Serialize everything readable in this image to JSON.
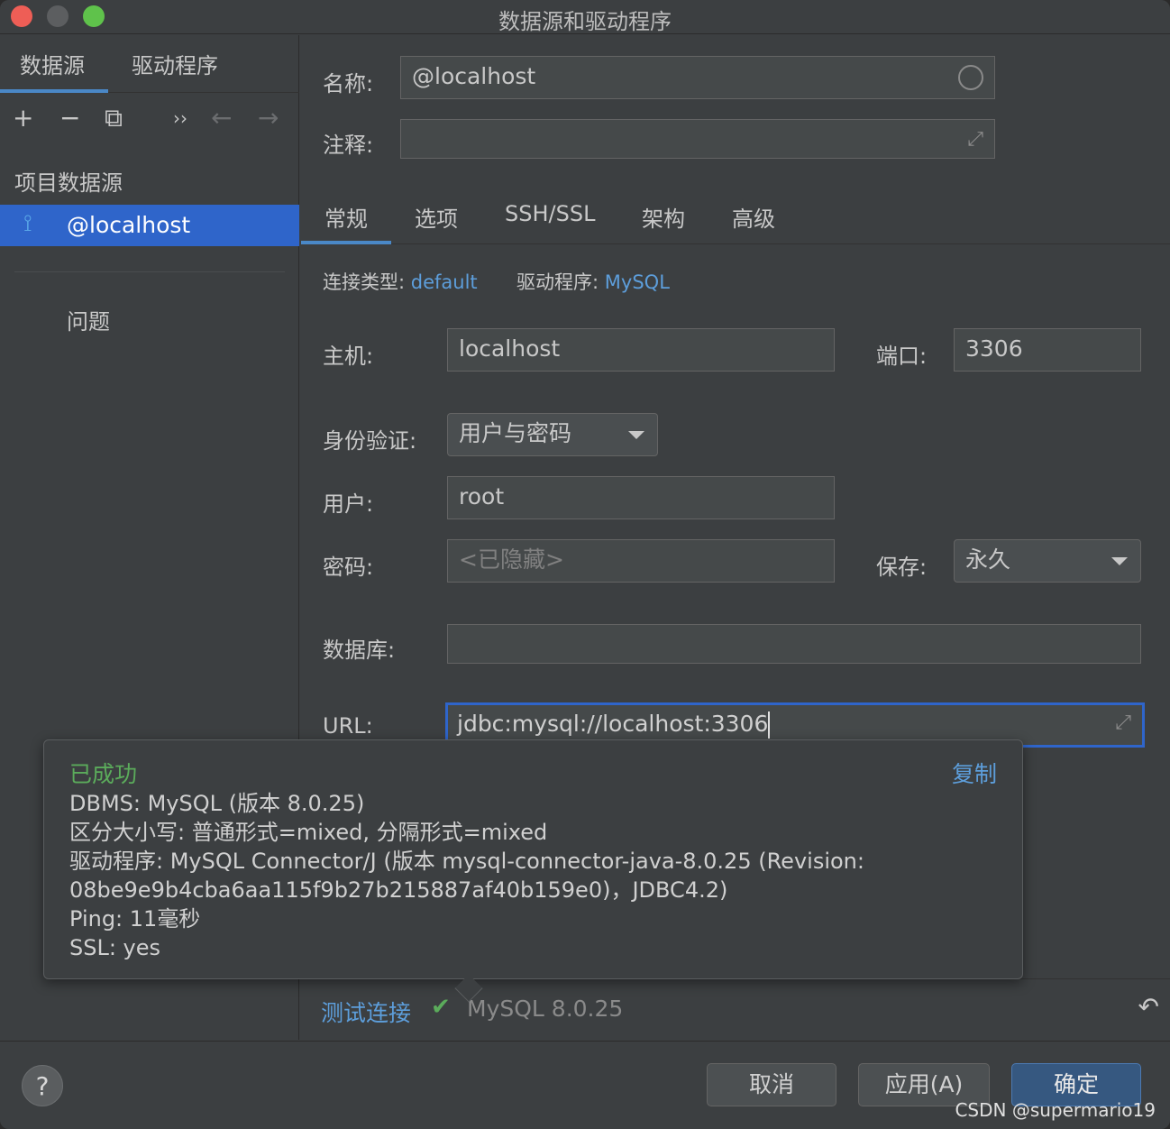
{
  "window": {
    "title": "数据源和驱动程序"
  },
  "left": {
    "tabs": [
      "数据源",
      "驱动程序"
    ],
    "toolbar": [
      "+",
      "−",
      "⧉",
      "››",
      "←",
      "→"
    ],
    "section_label": "项目数据源",
    "datasource": "@localhost",
    "problems": "问题"
  },
  "form": {
    "name_label": "名称:",
    "name_value": "@localhost",
    "comment_label": "注释:",
    "comment_value": "",
    "tabs": [
      "常规",
      "选项",
      "SSH/SSL",
      "架构",
      "高级"
    ],
    "conn_type_label": "连接类型:",
    "conn_type_value": "default",
    "driver_label": "驱动程序:",
    "driver_value": "MySQL",
    "host_label": "主机:",
    "host_value": "localhost",
    "port_label": "端口:",
    "port_value": "3306",
    "auth_label": "身份验证:",
    "auth_value": "用户与密码",
    "user_label": "用户:",
    "user_value": "root",
    "password_label": "密码:",
    "password_placeholder": "<已隐藏>",
    "save_label": "保存:",
    "save_value": "永久",
    "database_label": "数据库:",
    "database_value": "",
    "url_label": "URL:",
    "url_value": "jdbc:mysql://localhost:3306"
  },
  "popup": {
    "status": "已成功",
    "copy": "复制",
    "lines": [
      "DBMS: MySQL (版本 8.0.25)",
      "区分大小写: 普通形式=mixed, 分隔形式=mixed",
      "驱动程序: MySQL Connector/J (版本 mysql-connector-java-8.0.25 (Revision:",
      "08be9e9b4cba6aa115f9b27b215887af40b159e0)，JDBC4.2)",
      "Ping: 11毫秒",
      "SSL: yes"
    ]
  },
  "bottom": {
    "test_connection": "测试连接",
    "check_icon": "✔",
    "mysql_version": "MySQL 8.0.25",
    "undo_icon": "↶"
  },
  "footer": {
    "help": "?",
    "cancel": "取消",
    "apply": "应用(A)",
    "ok": "确定",
    "watermark": "CSDN @supermario19"
  },
  "colors": {
    "accent": "#2f65ca",
    "link": "#5d9edb",
    "success": "#5bab5b"
  }
}
